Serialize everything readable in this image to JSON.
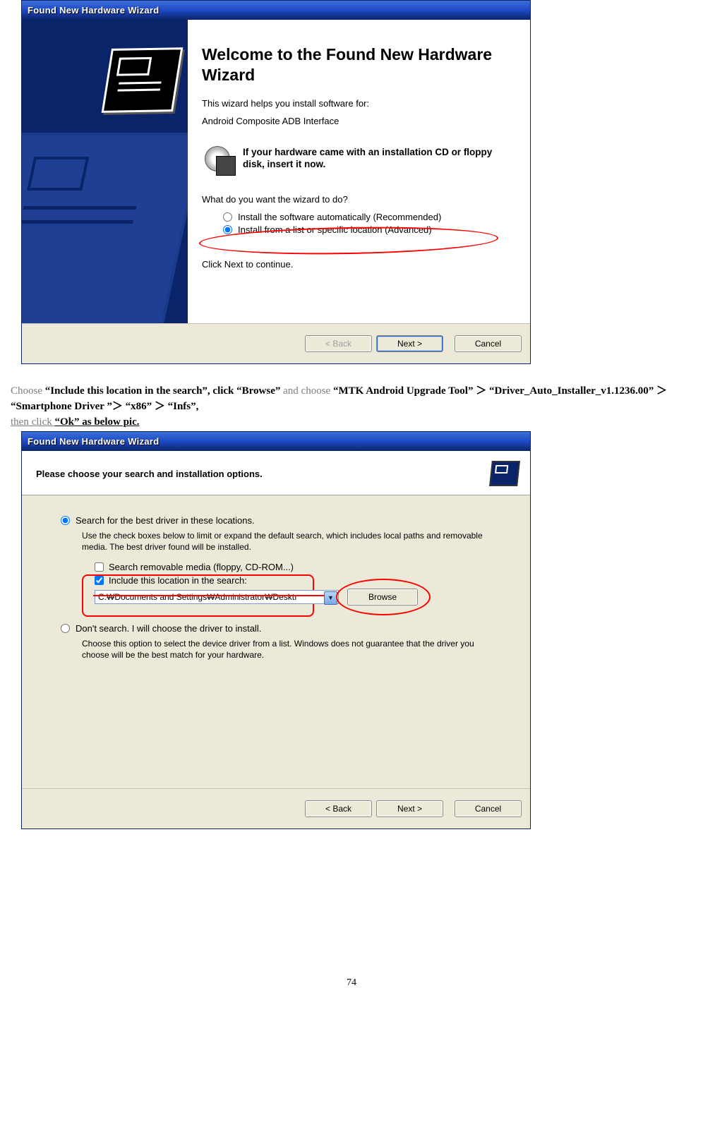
{
  "wiz1": {
    "title": "Found New Hardware Wizard",
    "heading": "Welcome to the Found New Hardware Wizard",
    "helps": "This wizard helps you install software for:",
    "device": "Android Composite ADB Interface",
    "cd_text": "If your hardware came with an installation CD or floppy disk, insert it now.",
    "question": "What do you want the wizard to do?",
    "radio_auto": "Install the software automatically (Recommended)",
    "radio_list": "Install from a list or specific location (Advanced)",
    "continue": "Click Next to continue.",
    "back": "< Back",
    "next": "Next >",
    "cancel": "Cancel"
  },
  "instr": {
    "p1a": "Choose ",
    "p1b": "“Include this location in the search”, click  “Browse”",
    "p1c": "and choose ",
    "p1d": "“MTK Android Upgrade Tool” ＞ “Driver_Auto_Installer_v1.1236.00” ＞  “Smartphone Driver ”＞ “x86” ＞ “Infs”",
    "p1e": ",",
    "p2a": "then click ",
    "p2b": "“Ok”  as below pic."
  },
  "wiz2": {
    "title": "Found New Hardware Wizard",
    "header": "Please choose your search and installation options.",
    "radio_search": "Search for the best driver in these locations.",
    "search_sub": "Use the check boxes below to limit or expand the default search, which includes local paths and removable media. The best driver found will be installed.",
    "chk_removable": "Search removable media (floppy, CD-ROM...)",
    "chk_include": "Include this location in the search:",
    "path": "C:₩Documents and Settings₩Administrator₩Desktı",
    "browse": "Browse",
    "radio_dont": "Don't search. I will choose the driver to install.",
    "dont_sub": "Choose this option to select the device driver from a list.  Windows does not guarantee that the driver you choose will be the best match for your hardware.",
    "back": "< Back",
    "next": "Next >",
    "cancel": "Cancel"
  },
  "pagenum": "74"
}
